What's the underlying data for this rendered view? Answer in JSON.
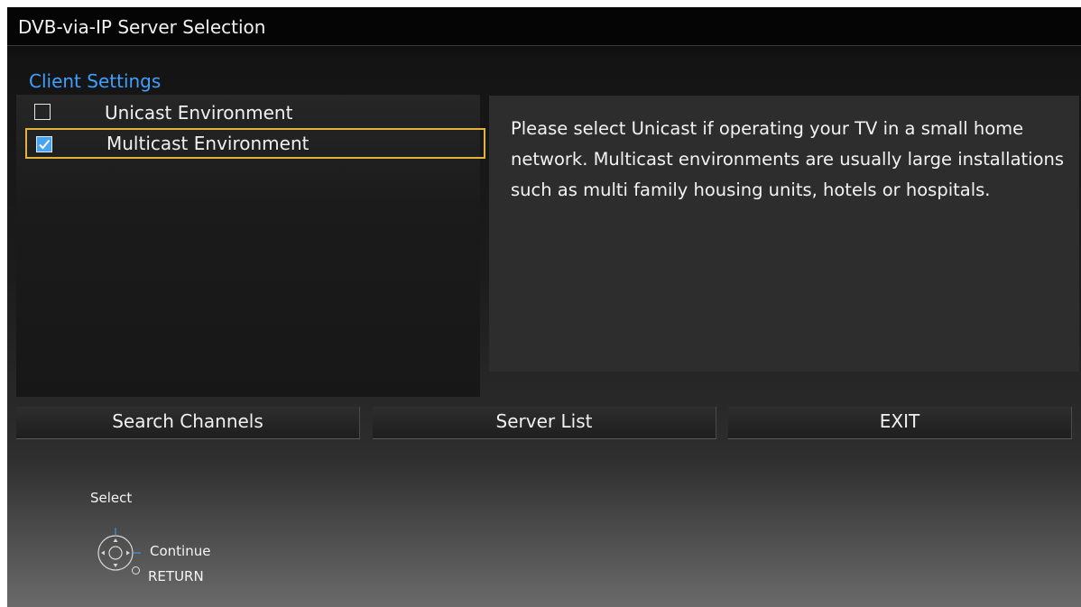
{
  "window": {
    "title": "DVB-via-IP Server Selection"
  },
  "client_settings": {
    "label": "Client Settings",
    "options": [
      {
        "label": "Unicast Environment",
        "checked": false,
        "selected": false
      },
      {
        "label": "Multicast Environment",
        "checked": true,
        "selected": true
      }
    ]
  },
  "description": "Please select Unicast if operating your TV in a small home network. Multicast environments are usually large installations such as multi family housing units, hotels or hospitals.",
  "buttons": {
    "search_channels": "Search Channels",
    "server_list": "Server List",
    "exit": "EXIT"
  },
  "hints": {
    "select": "Select",
    "continue": "Continue",
    "return": "RETURN"
  },
  "colors": {
    "accent_text": "#3ea0ff",
    "focus_border": "#e3b23c",
    "checkbox_checked": "#4aa3f0"
  },
  "icons": {
    "checkbox_checked": "checkmark-icon",
    "navigation": "dpad-icon",
    "return": "return-circle-icon"
  }
}
